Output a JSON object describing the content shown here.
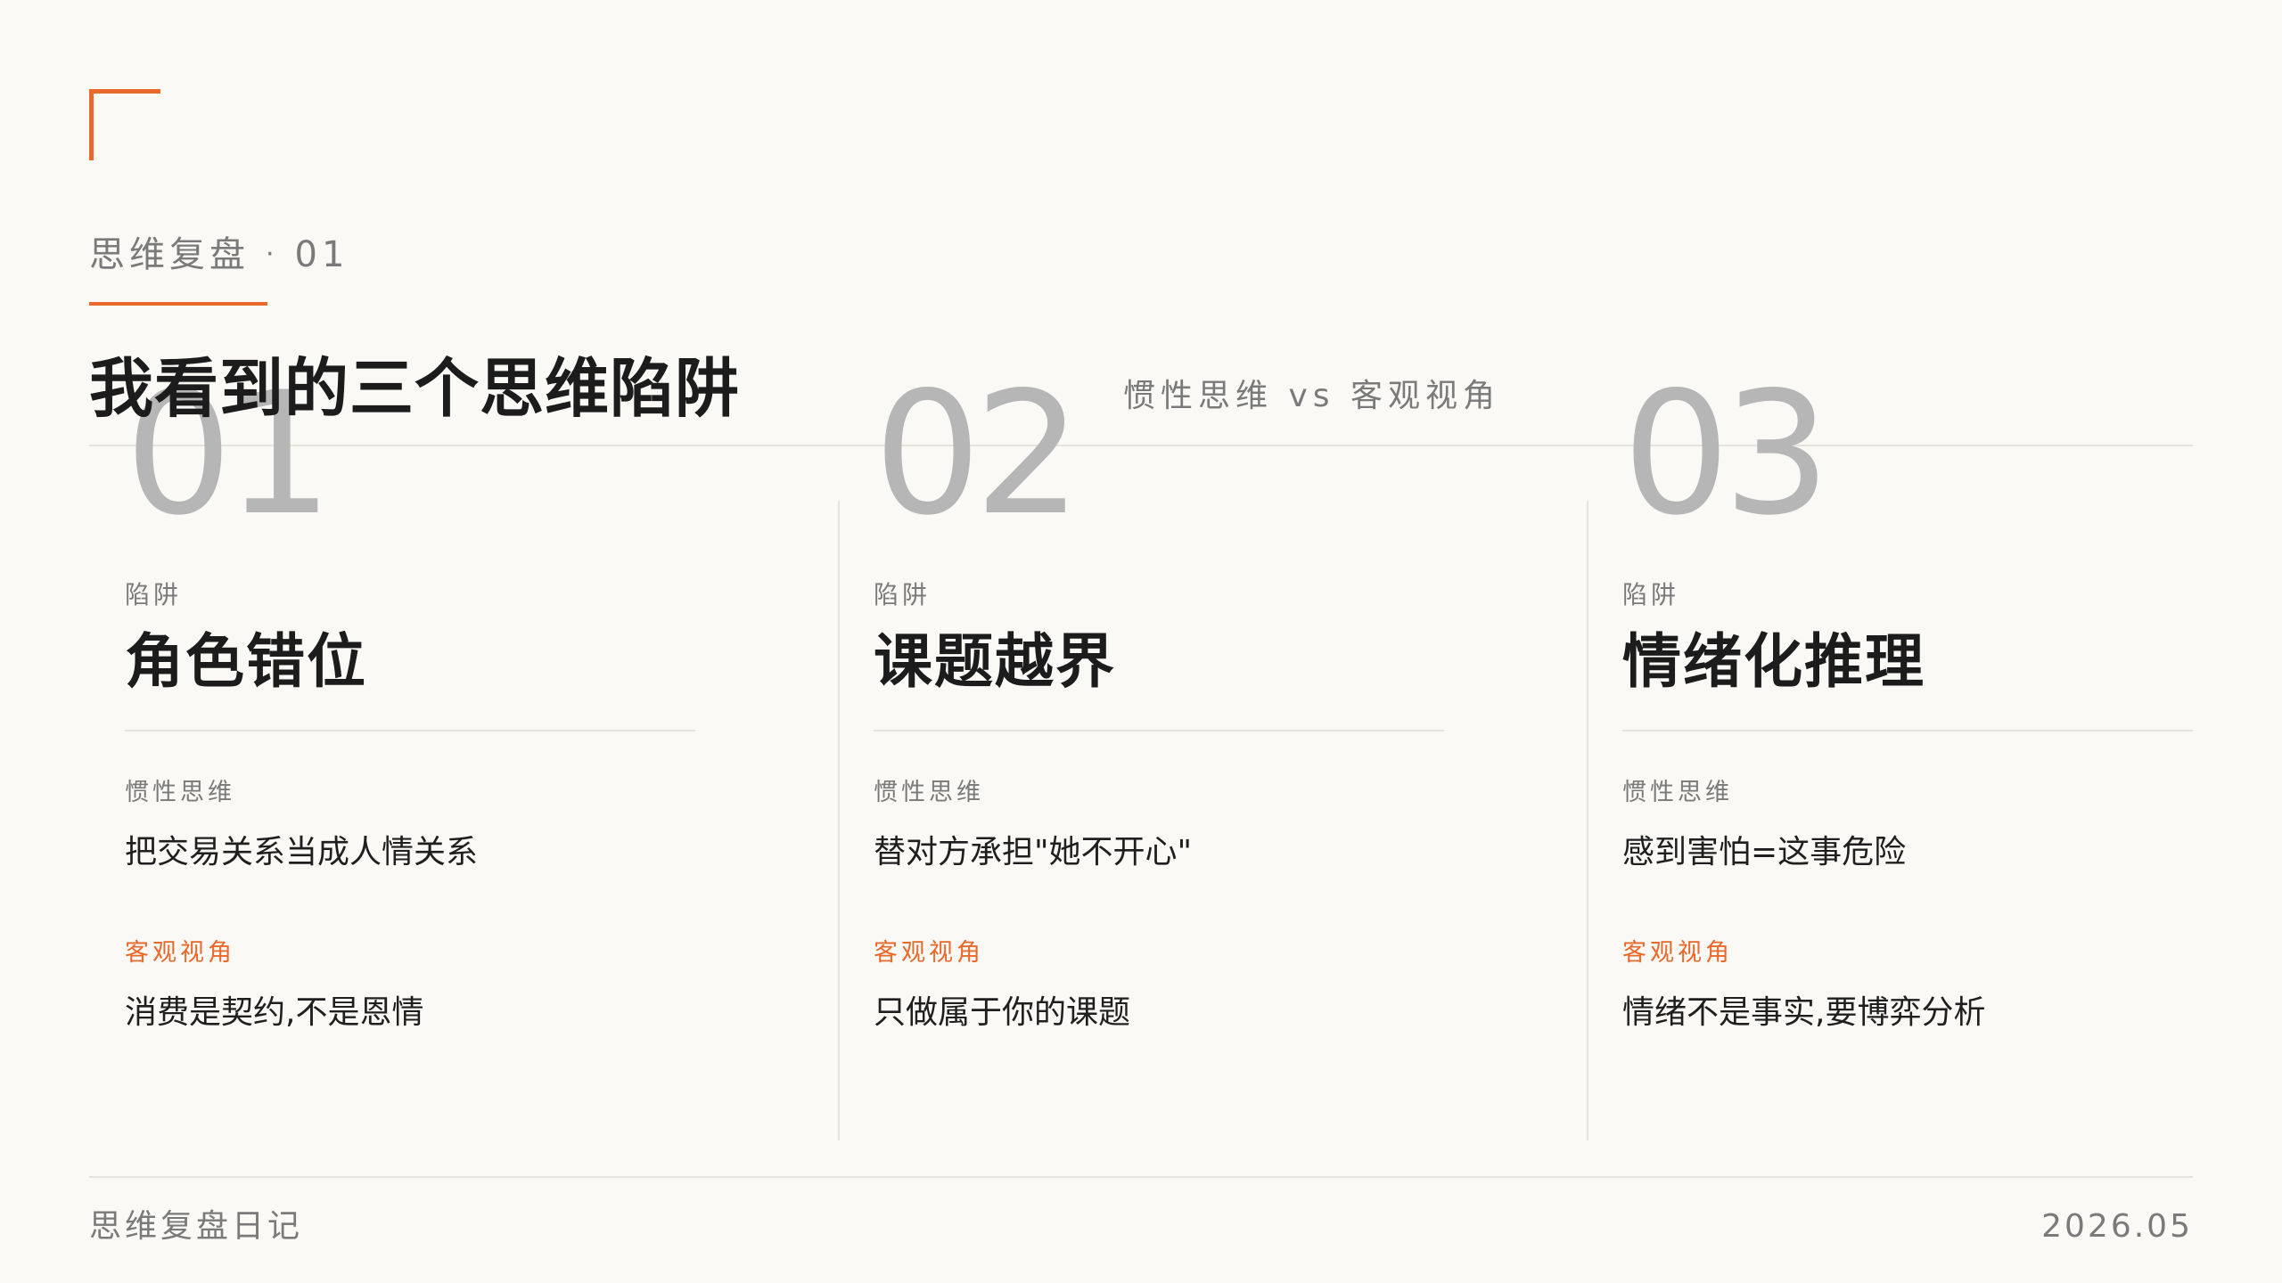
{
  "header": {
    "section_label": "思维复盘",
    "section_separator": "·",
    "section_number": "01",
    "title": "我看到的三个思维陷阱",
    "subtitle": "惯性思维 vs 客观视角"
  },
  "traps": [
    {
      "number": "01",
      "kicker": "陷阱",
      "title": "角色错位",
      "inertial_label": "惯性思维",
      "inertial_text": "把交易关系当成人情关系",
      "objective_label": "客观视角",
      "objective_text": "消费是契约,不是恩情"
    },
    {
      "number": "02",
      "kicker": "陷阱",
      "title": "课题越界",
      "inertial_label": "惯性思维",
      "inertial_text": "替对方承担\"她不开心\"",
      "objective_label": "客观视角",
      "objective_text": "只做属于你的课题"
    },
    {
      "number": "03",
      "kicker": "陷阱",
      "title": "情绪化推理",
      "inertial_label": "惯性思维",
      "inertial_text": "感到害怕=这事危险",
      "objective_label": "客观视角",
      "objective_text": "情绪不是事实,要博弈分析"
    }
  ],
  "footer": {
    "left": "思维复盘日记",
    "right": "2026.05"
  },
  "colors": {
    "accent": "#e8692a",
    "background": "#faf9f6",
    "muted_text": "#7a7a7a",
    "number": "#b6b6b6",
    "divider": "#e7e4df"
  }
}
